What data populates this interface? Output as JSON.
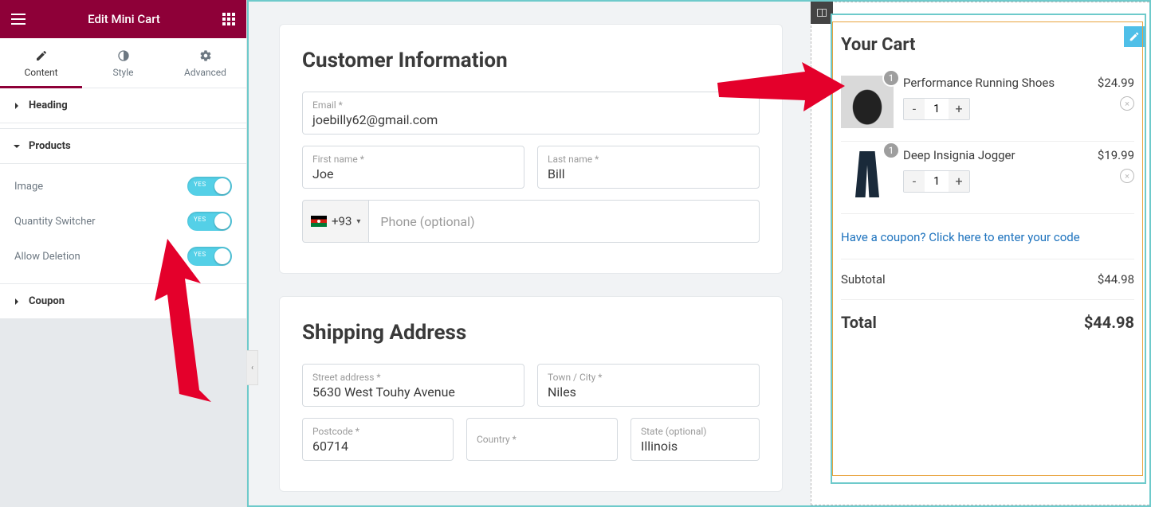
{
  "panel": {
    "title": "Edit Mini Cart",
    "tabs": {
      "content": "Content",
      "style": "Style",
      "advanced": "Advanced"
    },
    "sections": {
      "heading": "Heading",
      "products": "Products",
      "coupon": "Coupon"
    },
    "controls": {
      "image": "Image",
      "qty": "Quantity Switcher",
      "del": "Allow Deletion",
      "toggle_label": "YES"
    }
  },
  "customer": {
    "heading": "Customer Information",
    "email_label": "Email *",
    "email": "joebilly62@gmail.com",
    "first_label": "First name *",
    "first": "Joe",
    "last_label": "Last name *",
    "last": "Bill",
    "phone_code": "+93",
    "phone_placeholder": "Phone (optional)"
  },
  "shipping": {
    "heading": "Shipping Address",
    "street_label": "Street address *",
    "street": "5630 West Touhy Avenue",
    "town_label": "Town / City *",
    "town": "Niles",
    "postcode_label": "Postcode *",
    "postcode": "60714",
    "country_label": "Country *",
    "state_label": "State (optional)",
    "state": "Illinois"
  },
  "cart": {
    "title": "Your Cart",
    "items": [
      {
        "name": "Performance Running Shoes",
        "qty": "1",
        "price": "$24.99",
        "badge": "1"
      },
      {
        "name": "Deep Insignia Jogger",
        "qty": "1",
        "price": "$19.99",
        "badge": "1"
      }
    ],
    "coupon_link": "Have a coupon? Click here to enter your code",
    "subtotal_label": "Subtotal",
    "subtotal": "$44.98",
    "total_label": "Total",
    "total": "$44.98",
    "minus": "-",
    "plus": "+",
    "x": "×"
  }
}
